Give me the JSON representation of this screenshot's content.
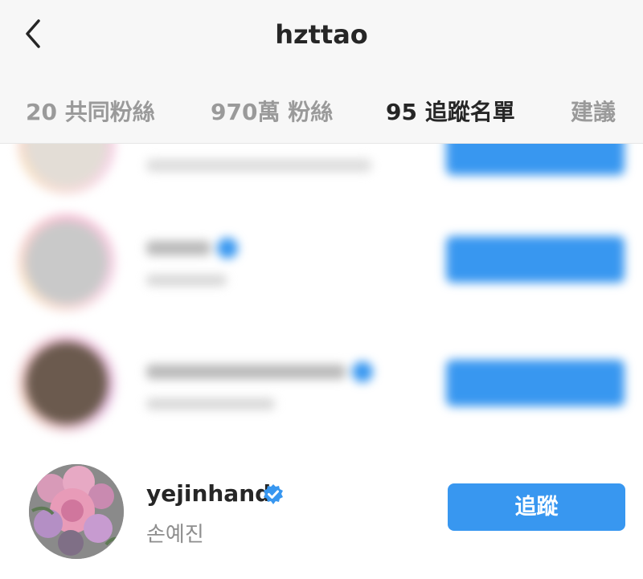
{
  "header": {
    "title": "hzttao",
    "tabs": [
      {
        "label": "20 共同粉絲",
        "active": false
      },
      {
        "label": "970萬 粉絲",
        "active": false
      },
      {
        "label": "95 追蹤名單",
        "active": true
      },
      {
        "label": "建議",
        "active": false
      }
    ]
  },
  "list": {
    "last_user": {
      "username": "yejinhand",
      "full_name": "손예진",
      "follow_label": "追蹤",
      "verified": true
    }
  },
  "colors": {
    "accent": "#3897f0",
    "verified": "#3897f0",
    "text_primary": "#262626",
    "text_secondary": "#8e8e8e"
  }
}
